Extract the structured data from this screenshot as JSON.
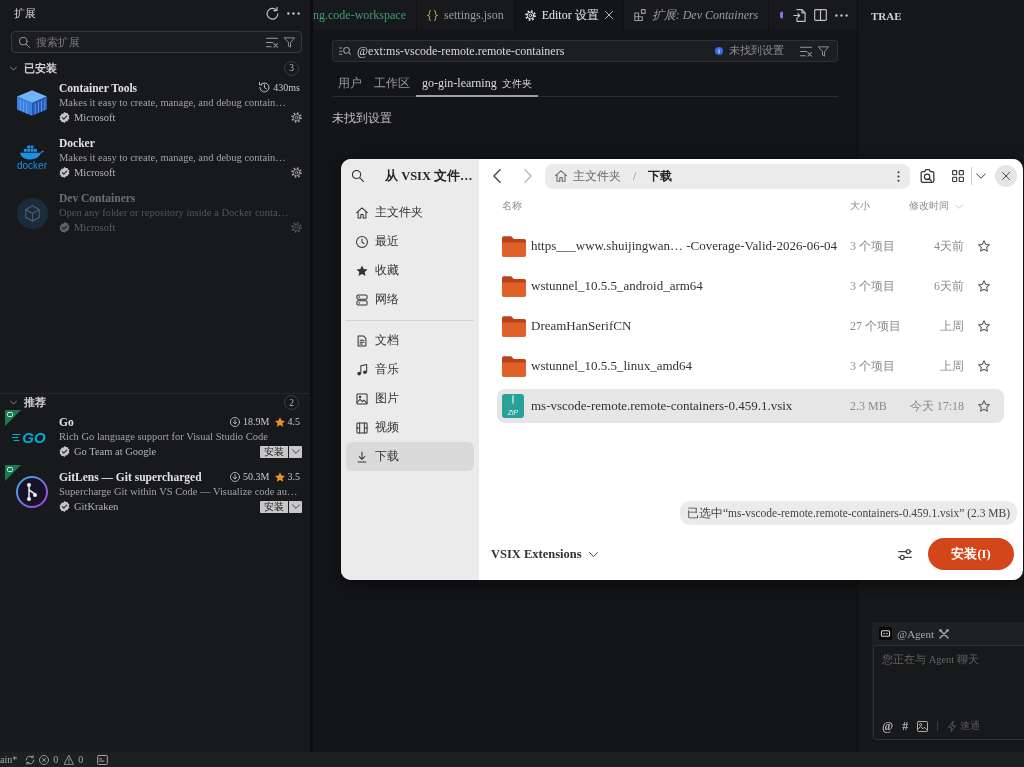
{
  "sidebar": {
    "title": "扩展",
    "search": {
      "placeholder": "搜索扩展"
    },
    "sections": [
      {
        "kind": "installed",
        "title": "已安装",
        "count": "3",
        "expanded": true,
        "items": [
          {
            "name": "Container Tools",
            "timing": "430ms",
            "description": "Makes it easy to create, manage, and debug contain…",
            "publisher": "Microsoft",
            "disabled": false
          },
          {
            "name": "Docker",
            "logo_text": "docker",
            "description": "Makes it easy to create, manage, and debug contain…",
            "publisher": "Microsoft",
            "disabled": false
          },
          {
            "name": "Dev Containers",
            "description": "Open any folder or repository inside a Docker conta…",
            "publisher": "Microsoft",
            "disabled": true
          }
        ]
      },
      {
        "kind": "recommended",
        "title": "推荐",
        "count": "2",
        "expanded": true,
        "items": [
          {
            "name": "Go",
            "logo_text": "GO",
            "downloads": "18.9M",
            "rating": "4.5",
            "description": "Rich Go language support for Visual Studio Code",
            "publisher": "Go Team at Google",
            "install": "安装"
          },
          {
            "name": "GitLens — Git supercharged",
            "downloads": "50.3M",
            "rating": "3.5",
            "description": "Supercharge Git within VS Code — Visualize code au…",
            "publisher": "GitKraken",
            "install": "安装"
          }
        ]
      }
    ]
  },
  "editor": {
    "tabs": [
      {
        "label": "ng.code-workspace",
        "color": "#3e9d6f",
        "selected": false,
        "preview": false
      },
      {
        "label": "settings.json",
        "selected": false,
        "preview": false
      },
      {
        "label": "Editor 设置",
        "selected": true,
        "preview": false
      },
      {
        "label": "扩展: Dev Containers",
        "selected": false,
        "preview": true
      }
    ],
    "settings": {
      "search": {
        "value": "@ext:ms-vscode-remote.remote-containers",
        "status": "未找到设置"
      },
      "scopes": [
        {
          "label": "用户",
          "selected": false
        },
        {
          "label": "工作区",
          "selected": false
        },
        {
          "label": "go-gin-learning",
          "note": "文件夹",
          "selected": true
        }
      ],
      "message": "未找到设置"
    }
  },
  "right_panel": {
    "title": "TRAE",
    "agent": {
      "name": "@Agent",
      "placeholder": "您正在与 Agent 聊天",
      "actions": [
        "@",
        "#"
      ],
      "mode": "速通"
    }
  },
  "status_bar": {
    "branch": "ain*",
    "errors": "0",
    "warnings": "0"
  },
  "dialog": {
    "title": "从 VSIX 文件…",
    "places": [
      {
        "items": [
          {
            "label": "主文件夹",
            "selected": false
          },
          {
            "label": "最近",
            "selected": false
          },
          {
            "label": "收藏",
            "selected": false
          },
          {
            "label": "网络",
            "selected": false
          }
        ]
      },
      {
        "items": [
          {
            "label": "文档",
            "selected": false
          },
          {
            "label": "音乐",
            "selected": false
          },
          {
            "label": "图片",
            "selected": false
          },
          {
            "label": "视频",
            "selected": false
          },
          {
            "label": "下载",
            "selected": true
          }
        ]
      }
    ],
    "back": {
      "disabled": false
    },
    "forward": {
      "disabled": true
    },
    "path": {
      "separator": "/",
      "items": [
        {
          "label": "主文件夹",
          "current": false
        },
        {
          "label": "下载",
          "current": true
        }
      ]
    },
    "columns": [
      {
        "label": "名称",
        "sorted": false
      },
      {
        "label": "大小",
        "sorted": false
      },
      {
        "label": "修改时间",
        "sorted": true
      }
    ],
    "files": [
      {
        "kind": "folder",
        "name": "https___www.shuijingwan… -Coverage-Valid-2026-06-04",
        "size": "3 个项目",
        "modified": "4天前",
        "starred": false,
        "selected": false
      },
      {
        "kind": "folder",
        "name": "wstunnel_10.5.5_android_arm64",
        "size": "3 个项目",
        "modified": "6天前",
        "starred": false,
        "selected": false
      },
      {
        "kind": "folder",
        "name": "DreamHanSerifCN",
        "size": "27 个项目",
        "modified": "上周",
        "starred": false,
        "selected": false
      },
      {
        "kind": "folder",
        "name": "wstunnel_10.5.5_linux_amd64",
        "size": "3 个项目",
        "modified": "上周",
        "starred": false,
        "selected": false
      },
      {
        "kind": "archive",
        "icon_label": "ZiP",
        "name": "ms-vscode-remote.remote-containers-0.459.1.vsix",
        "size": "2.3 MB",
        "modified": "今天 17:18",
        "starred": false,
        "selected": true
      }
    ],
    "selection": "已选中“ms-vscode-remote.remote-containers-0.459.1.vsix” (2.3 MB)",
    "filter": "VSIX Extensions",
    "confirm": "安装(I)"
  }
}
